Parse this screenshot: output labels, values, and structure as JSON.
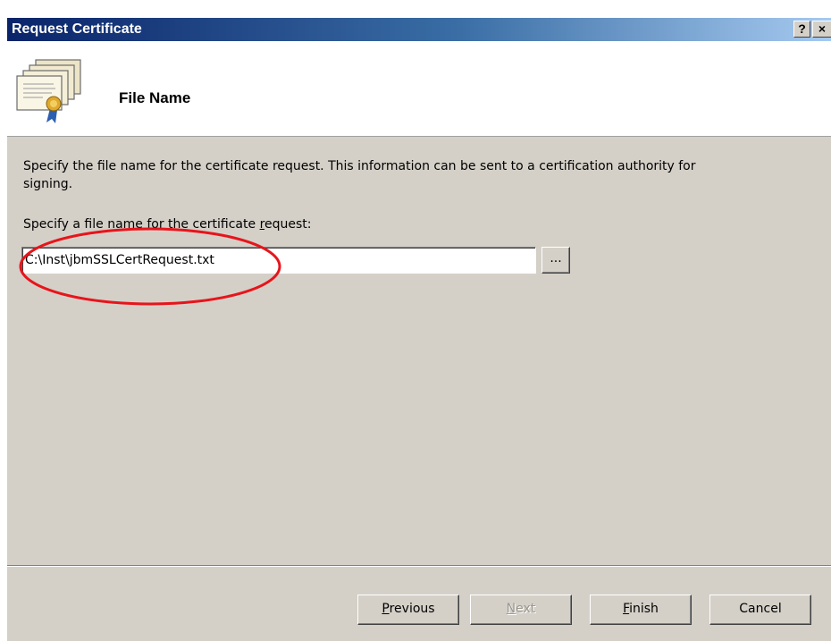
{
  "window": {
    "title": "Request Certificate",
    "help_glyph": "?",
    "close_glyph": "×"
  },
  "header": {
    "title": "File Name",
    "icon": "certificates-icon"
  },
  "body": {
    "description": "Specify the file name for the certificate request. This information can be sent to a certification authority for signing.",
    "field_label_pre": "Specify a file name for the certificate ",
    "field_label_accel": "r",
    "field_label_post": "equest:",
    "file_path": "C:\\Inst\\jbmSSLCertRequest.txt",
    "browse_label": "..."
  },
  "footer": {
    "previous": {
      "accel": "P",
      "rest": "revious"
    },
    "next": {
      "accel": "N",
      "rest": "ext",
      "enabled": false
    },
    "finish": {
      "accel": "F",
      "rest": "inish"
    },
    "cancel": "Cancel"
  },
  "annotation": {
    "color": "#e8141b"
  }
}
